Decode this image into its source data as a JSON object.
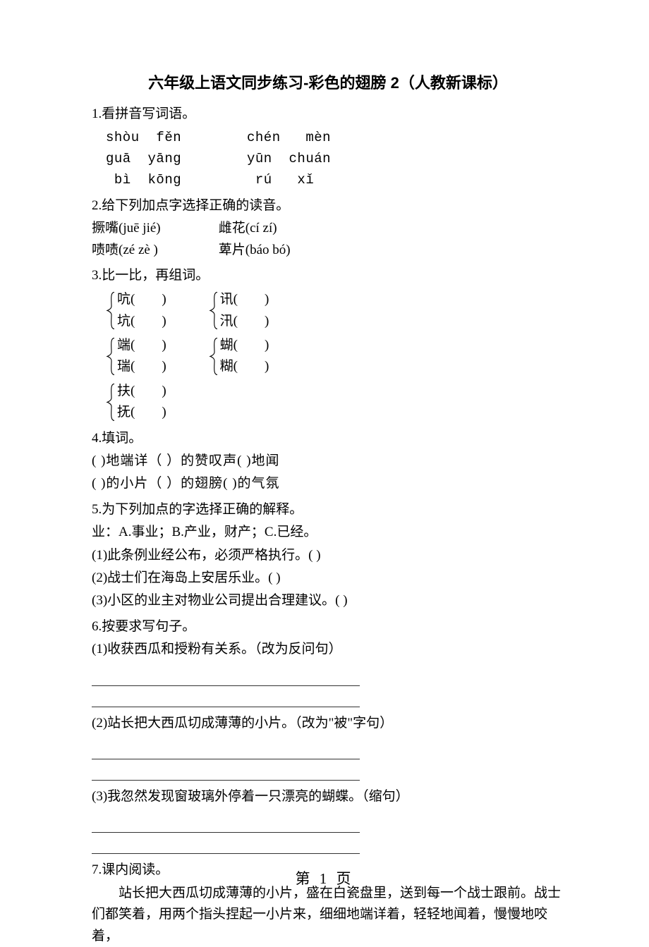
{
  "title": "六年级上语文同步练习-彩色的翅膀 2（人教新课标）",
  "q1": {
    "head": "1.看拼音写词语。",
    "rows": [
      {
        "c1": "shòu  fěn",
        "c2": "chén   mèn"
      },
      {
        "c1": "guā  yāng",
        "c2": "yūn  chuán"
      },
      {
        "c1": " bì  kōng",
        "c2": " rú   xǐ"
      }
    ]
  },
  "q2": {
    "head": "2.给下列加点字选择正确的读音。",
    "line1a": "撅嘴(juē jié)",
    "line1b": "雌花(cí zí)",
    "line2a": "啧啧(zé zè )",
    "line2b": "萆片(báo bó)"
  },
  "q3": {
    "head": "3.比一比，再组词。",
    "groups": [
      {
        "a": "吭(        )",
        "b": "坑(        )",
        "c": "讯(        )",
        "d": "汛(        )"
      },
      {
        "a": "端(        )",
        "b": "瑞(        )",
        "c": "蝴(        )",
        "d": "糊(        )"
      },
      {
        "a": "扶(        )",
        "b": "抚(        )"
      }
    ]
  },
  "q4": {
    "head": "4.填词。",
    "line1": "(      )地端详（     ）的赞叹声(      )地闻",
    "line2": "(      )的小片（     ）的翅膀(      )的气氛"
  },
  "q5": {
    "head": "5.为下列加点的字选择正确的解释。",
    "def": "业：A.事业；B.产业，财产；C.已经。",
    "i1": "(1)此条例业经公布，必须严格执行。(      )",
    "i2": "(2)战士们在海岛上安居乐业。(    )",
    "i3": "(3)小区的业主对物业公司提出合理建议。(      )"
  },
  "q6": {
    "head": "6.按要求写句子。",
    "i1": "(1)收获西瓜和授粉有关系。（改为反问句）",
    "i2": "(2)站长把大西瓜切成薄薄的小片。（改为\"被\"字句）",
    "i3": "(3)我忽然发现窗玻璃外停着一只漂亮的蝴蝶。（缩句）"
  },
  "q7": {
    "head": "7.课内阅读。",
    "body": "站长把大西瓜切成薄薄的小片，盛在白瓷盘里，送到每一个战士跟前。战士们都笑着，用两个指头捏起一小片来，细细地端详着，轻轻地闻着，慢慢地咬着，"
  },
  "footer": "第 1 页"
}
